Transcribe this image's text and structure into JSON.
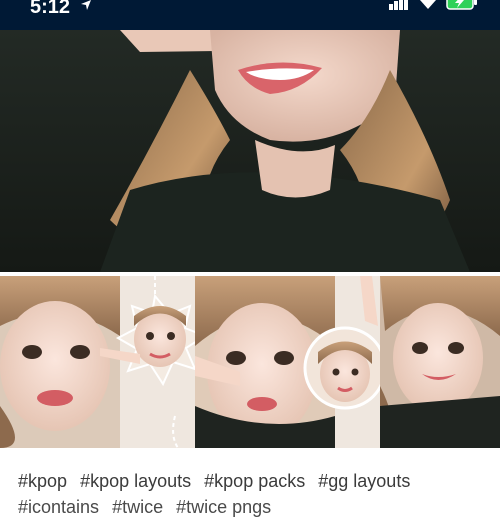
{
  "status_bar": {
    "time": "5:12",
    "icons": [
      "navigation-icon",
      "signal-icon",
      "wifi-icon",
      "battery-charging-icon"
    ],
    "background": "#001935"
  },
  "post": {
    "images": [
      {
        "name": "selfie-close-up-photo"
      },
      {
        "name": "kpop-layout-collage-photo"
      }
    ],
    "tags_line1": [
      "#kpop",
      "#kpop layouts",
      "#kpop packs",
      "#gg layouts"
    ],
    "tags_line2": [
      "#icontains",
      "#twice",
      "#twice pngs"
    ]
  }
}
